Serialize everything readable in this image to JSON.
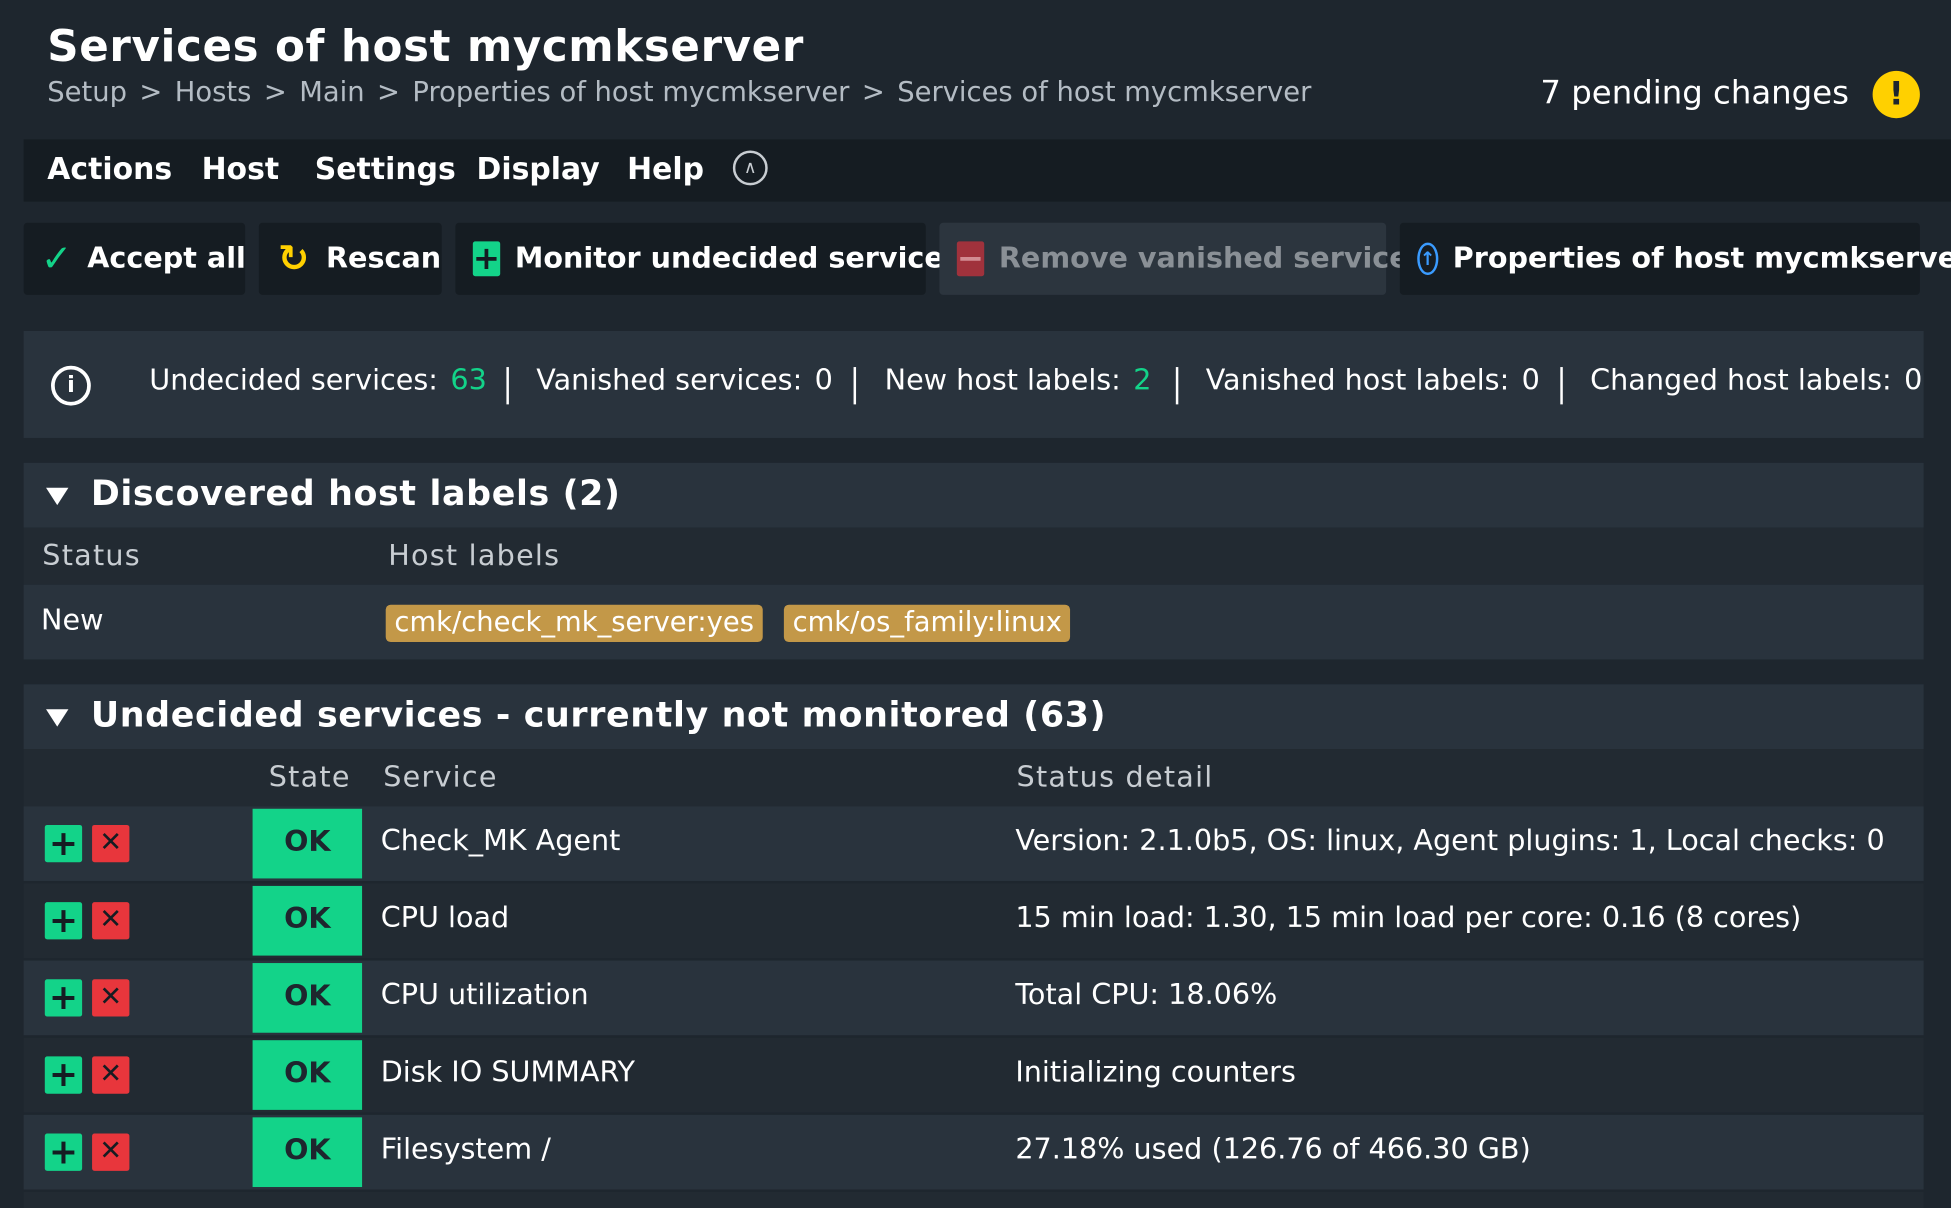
{
  "header": {
    "title": "Services of host mycmkserver",
    "breadcrumb": [
      "Setup",
      "Hosts",
      "Main",
      "Properties of host mycmkserver",
      "Services of host mycmkserver"
    ],
    "breadcrumb_separator": ">",
    "pending_changes": "7 pending changes",
    "pending_icon": "!"
  },
  "menu": [
    "Actions",
    "Host",
    "Settings",
    "Display",
    "Help"
  ],
  "actions": {
    "accept_all": "Accept all",
    "rescan": "Rescan",
    "monitor_undecided": "Monitor undecided services",
    "remove_vanished": "Remove vanished services",
    "properties": "Properties of host mycmkserver"
  },
  "summary": {
    "undecided_label": "Undecided services:",
    "undecided_value": "63",
    "vanished_label": "Vanished services:",
    "vanished_value": "0",
    "new_labels_label": "New host labels:",
    "new_labels_value": "2",
    "vanished_labels_label": "Vanished host labels:",
    "vanished_labels_value": "0",
    "changed_labels_label": "Changed host labels:",
    "changed_labels_value": "0"
  },
  "host_labels_section": {
    "title": "Discovered host labels (2)",
    "col_status": "Status",
    "col_labels": "Host labels",
    "row": {
      "status": "New",
      "labels": [
        "cmk/check_mk_server:yes",
        "cmk/os_family:linux"
      ]
    }
  },
  "services_section": {
    "title": "Undecided services - currently not monitored (63)",
    "col_state": "State",
    "col_service": "Service",
    "col_detail": "Status detail",
    "rows": [
      {
        "state": "OK",
        "service": "Check_MK Agent",
        "detail": "Version: 2.1.0b5, OS: linux, Agent plugins: 1, Local checks: 0"
      },
      {
        "state": "OK",
        "service": "CPU load",
        "detail": "15 min load: 1.30, 15 min load per core: 0.16 (8 cores)"
      },
      {
        "state": "OK",
        "service": "CPU utilization",
        "detail": "Total CPU: 18.06%"
      },
      {
        "state": "OK",
        "service": "Disk IO SUMMARY",
        "detail": "Initializing counters"
      },
      {
        "state": "OK",
        "service": "Filesystem /",
        "detail": "27.18% used (126.76 of 466.30 GB)"
      }
    ]
  },
  "colors": {
    "background": "#1e262e",
    "ok_green": "#13d389",
    "remove_red": "#e8363c",
    "label_chip": "#c39848",
    "warning_yellow": "#ffd000",
    "link_blue": "#3a9bff"
  },
  "icons": {
    "accept": "check-icon",
    "rescan": "rescan-icon",
    "monitor": "plus-icon",
    "remove": "minus-icon",
    "properties": "arrow-up-circle-icon",
    "info": "info-icon",
    "collapse": "chevron-up-icon",
    "warning": "exclamation-icon"
  }
}
